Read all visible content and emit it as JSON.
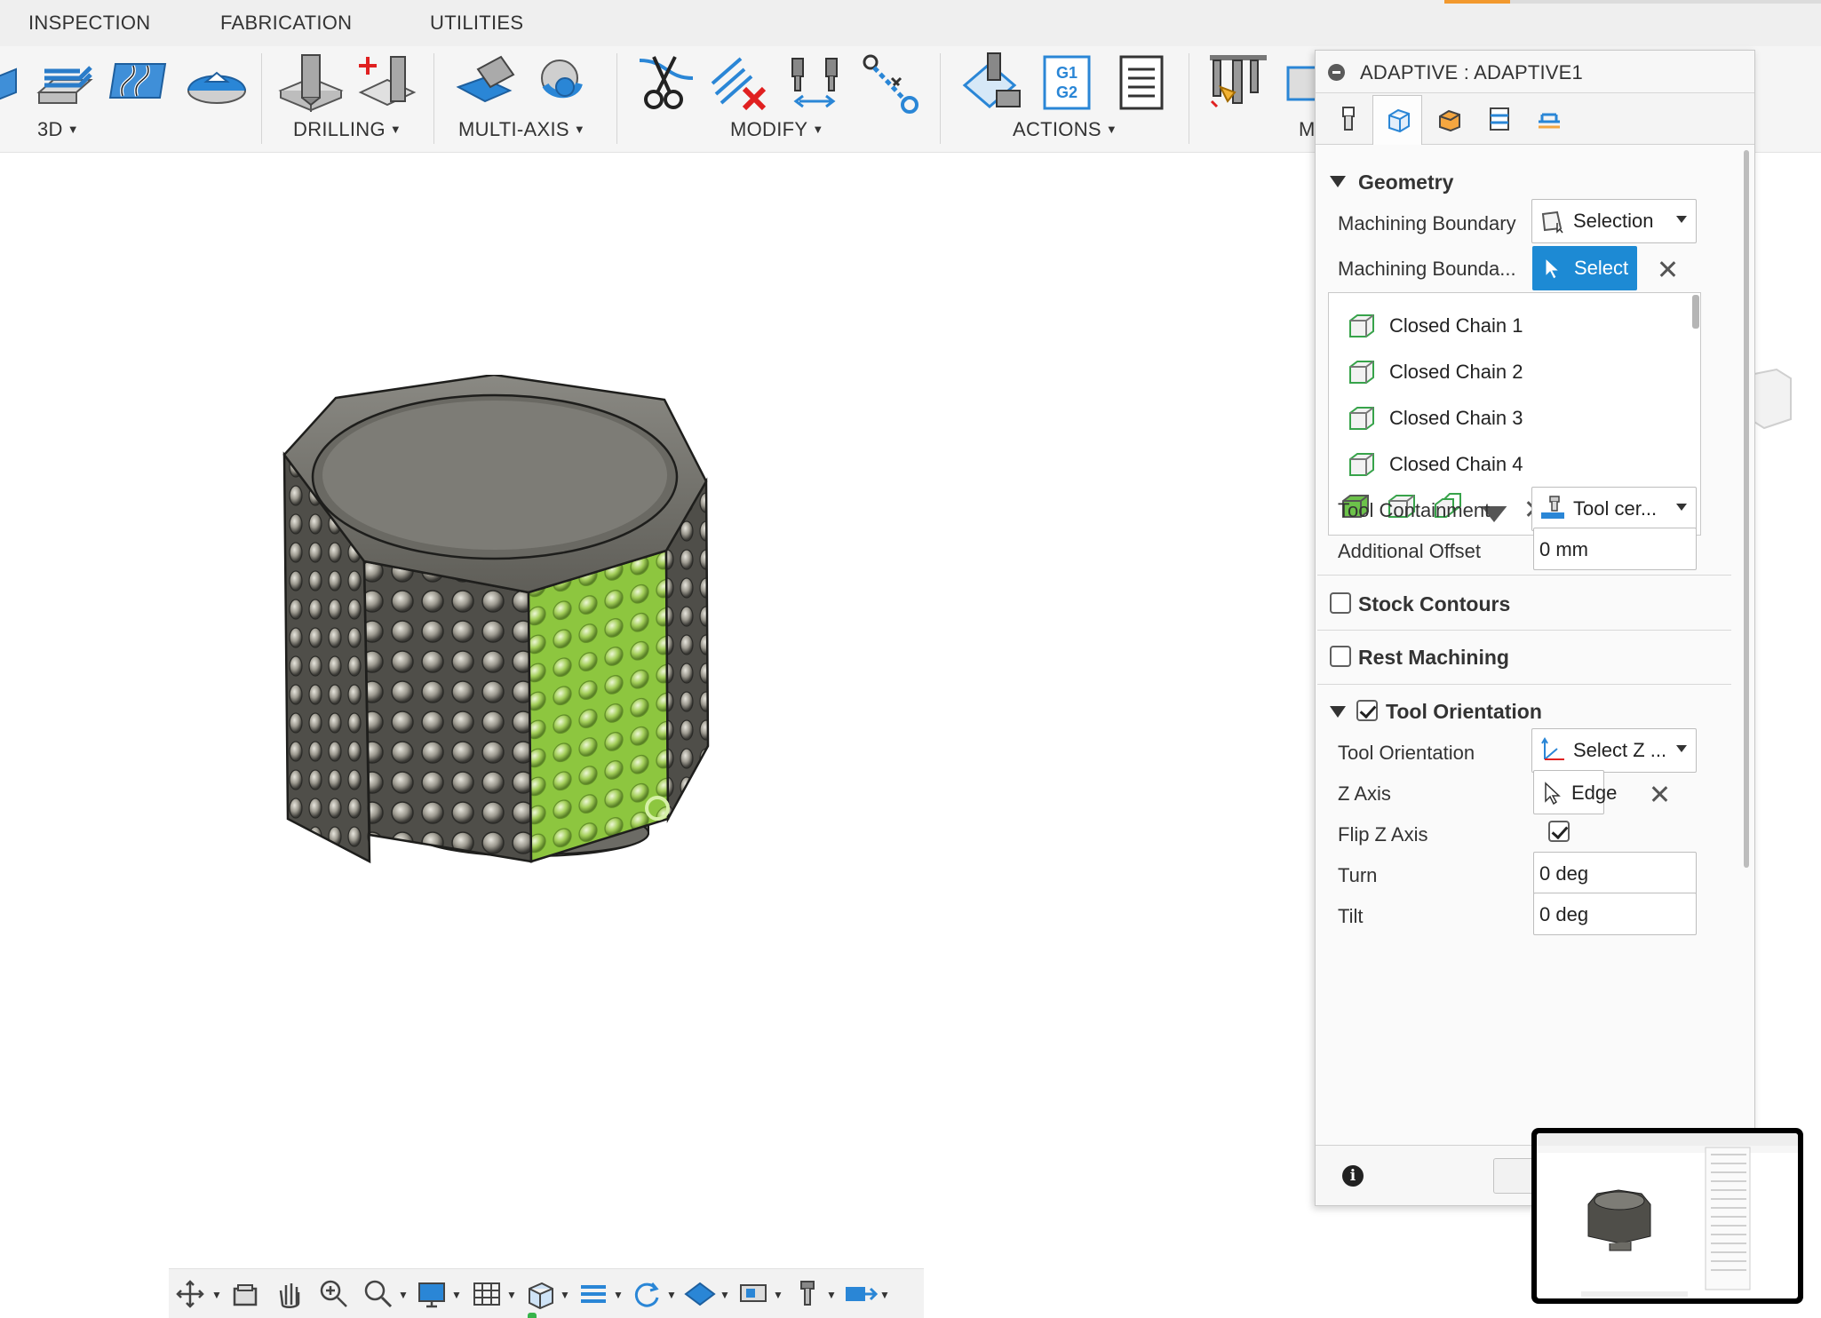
{
  "tabs": [
    "INSPECTION",
    "FABRICATION",
    "UTILITIES"
  ],
  "ribbon": {
    "groups": [
      {
        "label": "3D"
      },
      {
        "label": "DRILLING"
      },
      {
        "label": "MULTI-AXIS"
      },
      {
        "label": "MODIFY"
      },
      {
        "label": "ACTIONS"
      },
      {
        "label": "M"
      }
    ],
    "actions_g1g2_icon": {
      "line1": "G1",
      "line2": "G2"
    }
  },
  "dialog": {
    "title": "ADAPTIVE : ADAPTIVE1",
    "tabs": [
      "tool-tab",
      "geometry-tab",
      "heights-tab",
      "passes-tab",
      "linking-tab"
    ],
    "geometry": {
      "header": "Geometry",
      "machining_boundary_label": "Machining Boundary",
      "machining_boundary_value": "Selection",
      "machining_boundary_sel_label": "Machining Bounda...",
      "select_button": "Select",
      "chains": [
        "Closed Chain 1",
        "Closed Chain 2",
        "Closed Chain 3",
        "Closed Chain 4"
      ],
      "tool_containment_label": "Tool Containment",
      "tool_containment_value": "Tool cer...",
      "additional_offset_label": "Additional Offset",
      "additional_offset_value": "0 mm"
    },
    "stock_contours": {
      "label": "Stock Contours",
      "checked": false
    },
    "rest_machining": {
      "label": "Rest Machining",
      "checked": false
    },
    "tool_orientation": {
      "header": "Tool Orientation",
      "checked": true,
      "orientation_label": "Tool Orientation",
      "orientation_value": "Select Z ...",
      "z_axis_label": "Z Axis",
      "z_axis_value": "Edge",
      "flip_z_label": "Flip Z Axis",
      "flip_z_checked": true,
      "turn_label": "Turn",
      "turn_value": "0 deg",
      "tilt_label": "Tilt",
      "tilt_value": "0 deg"
    }
  },
  "colors": {
    "accent_blue": "#1d8ad4",
    "selection_green": "#8dc63f",
    "tab_accent": "#f2992e",
    "model_gray": "#5b5a55"
  }
}
